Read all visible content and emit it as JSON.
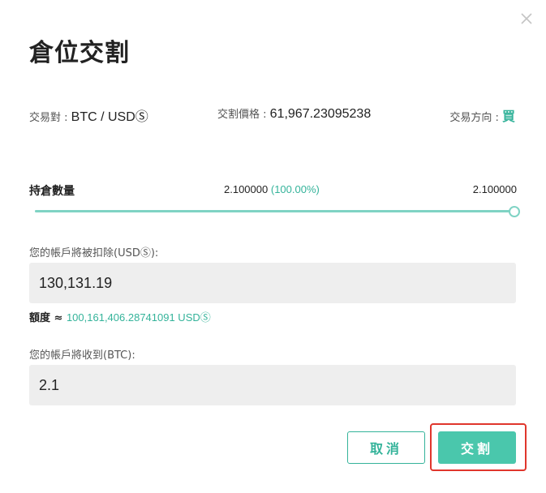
{
  "dialog": {
    "title": "倉位交割",
    "close_icon": "close-icon"
  },
  "info": {
    "pair_label": "交易對 : ",
    "pair_value": "BTC / USDⓈ",
    "price_label": "交割價格 : ",
    "price_value": "61,967.23095238",
    "direction_label": "交易方向 : ",
    "direction_value": "買"
  },
  "position": {
    "label": "持倉數量",
    "current": "2.100000",
    "percent": "(100.00%)",
    "max": "2.100000",
    "slider_fraction": 1.0
  },
  "deduct": {
    "label": "您的帳戶將被扣除(USDⓈ):",
    "value": "130,131.19",
    "quota_label": "額度 ≈ ",
    "quota_value": "100,161,406.28741091 USDⓈ"
  },
  "receive": {
    "label": "您的帳戶將收到(BTC):",
    "value": "2.1"
  },
  "actions": {
    "cancel_label": "取消",
    "confirm_label": "交割"
  },
  "colors": {
    "accent": "#34b39a",
    "confirm_bg": "#4ac7ac",
    "highlight": "#e0362c"
  }
}
